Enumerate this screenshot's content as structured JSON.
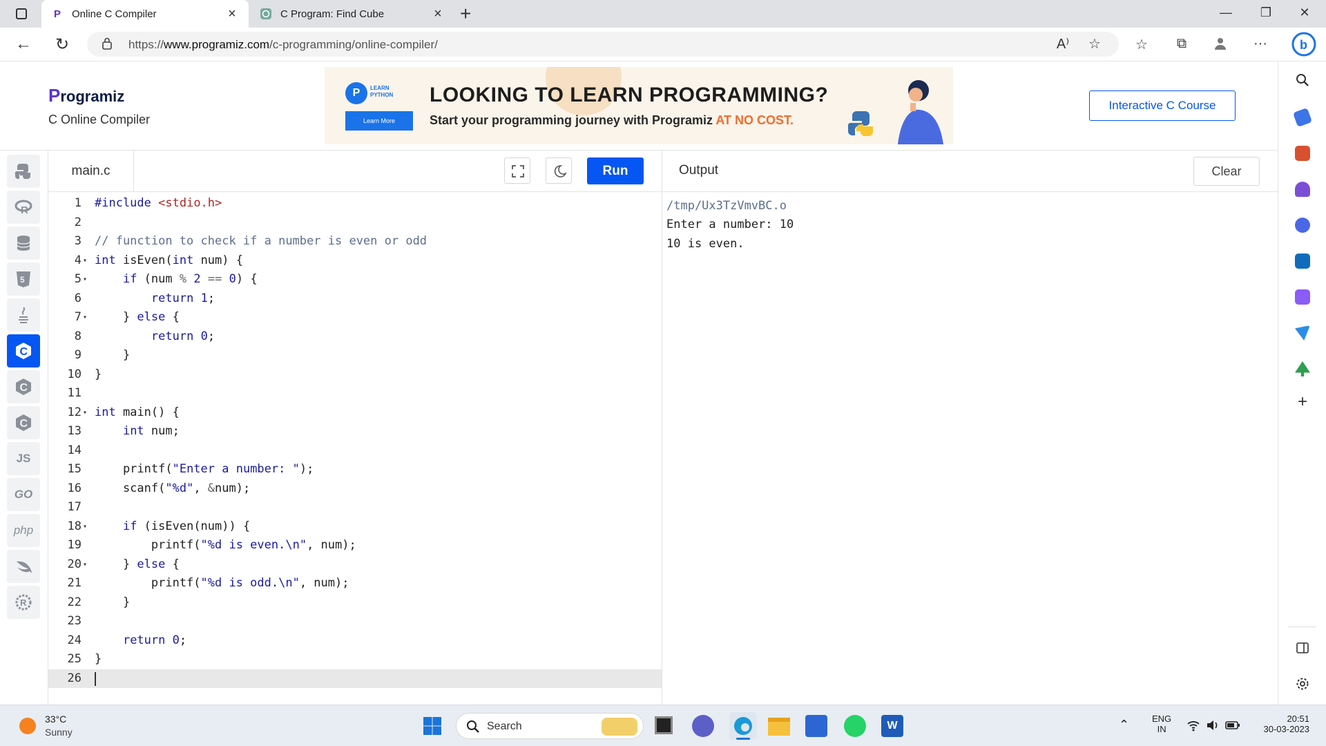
{
  "browser": {
    "tabs": [
      {
        "title": "Online C Compiler",
        "active": true
      },
      {
        "title": "C Program: Find Cube",
        "active": false
      }
    ],
    "url_prefix": "https://",
    "url_domain": "www.programiz.com",
    "url_path": "/c-programming/online-compiler/",
    "read_aloud_icon": "A⁾"
  },
  "header": {
    "logo": "rogramiz",
    "logo_initial": "P",
    "subtitle": "C Online Compiler",
    "course_button": "Interactive C Course"
  },
  "banner": {
    "badge_top": "LEARN",
    "badge_bottom": "PYTHON",
    "learn_more": "Learn More",
    "headline": "LOOKING TO LEARN PROGRAMMING?",
    "tagline": "Start your programming journey with Programiz ",
    "tagline_highlight": "AT NO COST."
  },
  "languages": [
    "python",
    "r",
    "sql",
    "html",
    "java",
    "c",
    "cpp",
    "csharp",
    "js",
    "go",
    "php",
    "swift",
    "rust"
  ],
  "lang_text": {
    "js": "JS",
    "go": "GO",
    "php": "php"
  },
  "editor": {
    "filename": "main.c",
    "run_label": "Run",
    "current_line": 26
  },
  "code_lines": [
    "#include <stdio.h>",
    "",
    "// function to check if a number is even or odd",
    "int isEven(int num) {",
    "    if (num % 2 == 0) {",
    "        return 1;",
    "    } else {",
    "        return 0;",
    "    }",
    "}",
    "",
    "int main() {",
    "    int num;",
    "",
    "    printf(\"Enter a number: \");",
    "    scanf(\"%d\", &num);",
    "",
    "    if (isEven(num)) {",
    "        printf(\"%d is even.\\n\", num);",
    "    } else {",
    "        printf(\"%d is odd.\\n\", num);",
    "    }",
    "",
    "    return 0;",
    "}",
    ""
  ],
  "fold_lines": [
    4,
    5,
    7,
    12,
    18,
    20
  ],
  "output": {
    "title": "Output",
    "clear_label": "Clear",
    "lines": [
      "/tmp/Ux3TzVmvBC.o",
      "Enter a number: 10",
      "10 is even."
    ]
  },
  "taskbar": {
    "temperature": "33°C",
    "condition": "Sunny",
    "search_label": "Search",
    "lang_top": "ENG",
    "lang_bottom": "IN",
    "time": "20:51",
    "date": "30-03-2023"
  },
  "colors": {
    "accent": "#0556f3",
    "highlight": "#f46b2c"
  }
}
